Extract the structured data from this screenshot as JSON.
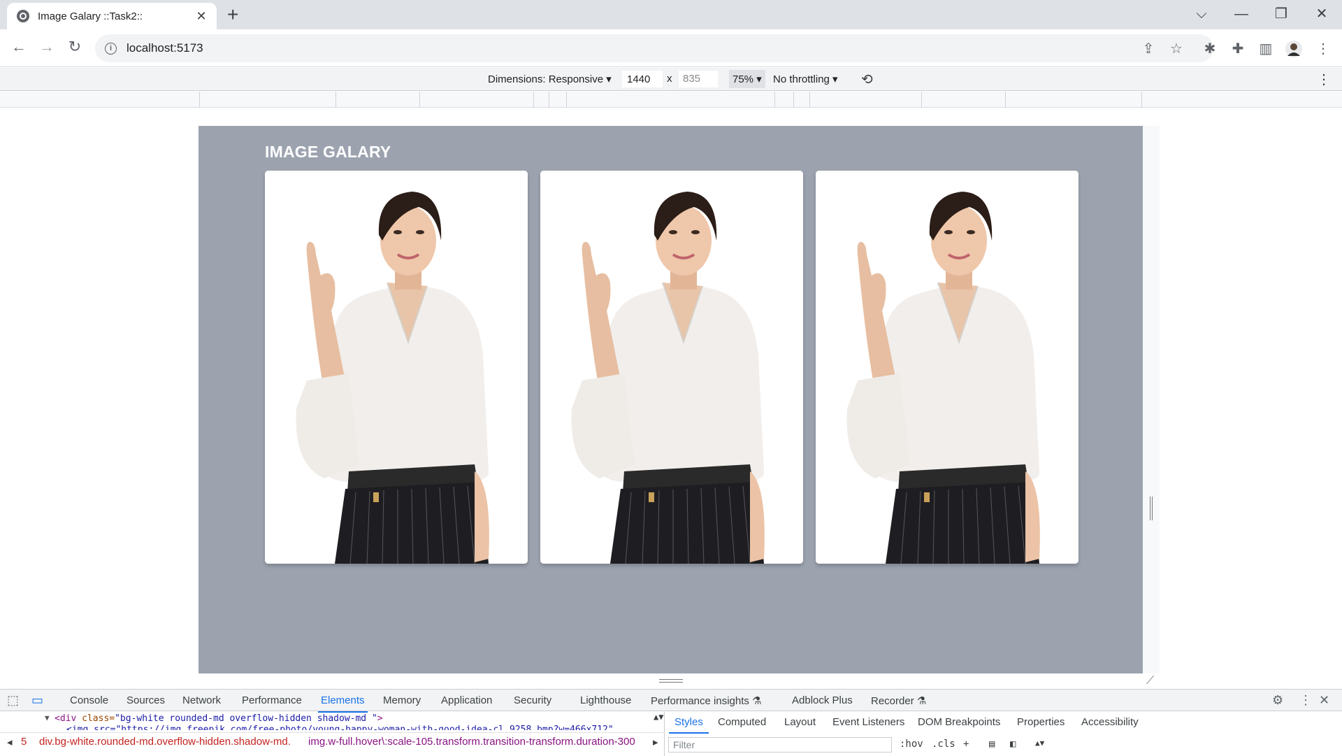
{
  "browser": {
    "tab_title": "Image Galary ::Task2::",
    "tab_close": "✕",
    "new_tab": "+",
    "url": "localhost:5173",
    "window_controls": {
      "dropdown": "⌵",
      "minimize": "—",
      "restore": "❐",
      "close": "✕"
    }
  },
  "device_toolbar": {
    "dimensions_label": "Dimensions: Responsive ▾",
    "width": "1440",
    "times": "x",
    "height": "835",
    "zoom": "75% ▾",
    "throttling": "No throttling ▾"
  },
  "page": {
    "title": "IMAGE GALARY",
    "background_color": "#9ca3af",
    "cards": [
      {
        "image_icon": "woman-pointing-photo"
      },
      {
        "image_icon": "woman-pointing-photo"
      },
      {
        "image_icon": "woman-pointing-photo"
      }
    ]
  },
  "devtools": {
    "tabs": [
      "Console",
      "Sources",
      "Network",
      "Performance",
      "Elements",
      "Memory",
      "Application",
      "Security",
      "Lighthouse",
      "Performance insights ⚗",
      "Adblock Plus",
      "Recorder ⚗"
    ],
    "active_tab": "Elements",
    "dom_line_tag": "<div",
    "dom_line_attr": "class=",
    "dom_line_value": "\"bg-white rounded-md overflow-hidden shadow-md \"",
    "dom_line_close": ">",
    "dom_line2": "<img src=\"https://img.freepik.com/free-photo/young-happy-woman-with-good-idea-cl_9258.bmp?w=466x712\"",
    "crumb_index": "5",
    "crumb_1": "div.bg-white.rounded-md.overflow-hidden.shadow-md.",
    "crumb_2": "img.w-full.hover\\:scale-105.transform.transition-transform.duration-300",
    "side_tabs": [
      "Styles",
      "Computed",
      "Layout",
      "Event Listeners",
      "DOM Breakpoints",
      "Properties",
      "Accessibility"
    ],
    "filter_placeholder": "Filter",
    "hov": ":hov",
    "cls": ".cls",
    "plus": "+"
  }
}
